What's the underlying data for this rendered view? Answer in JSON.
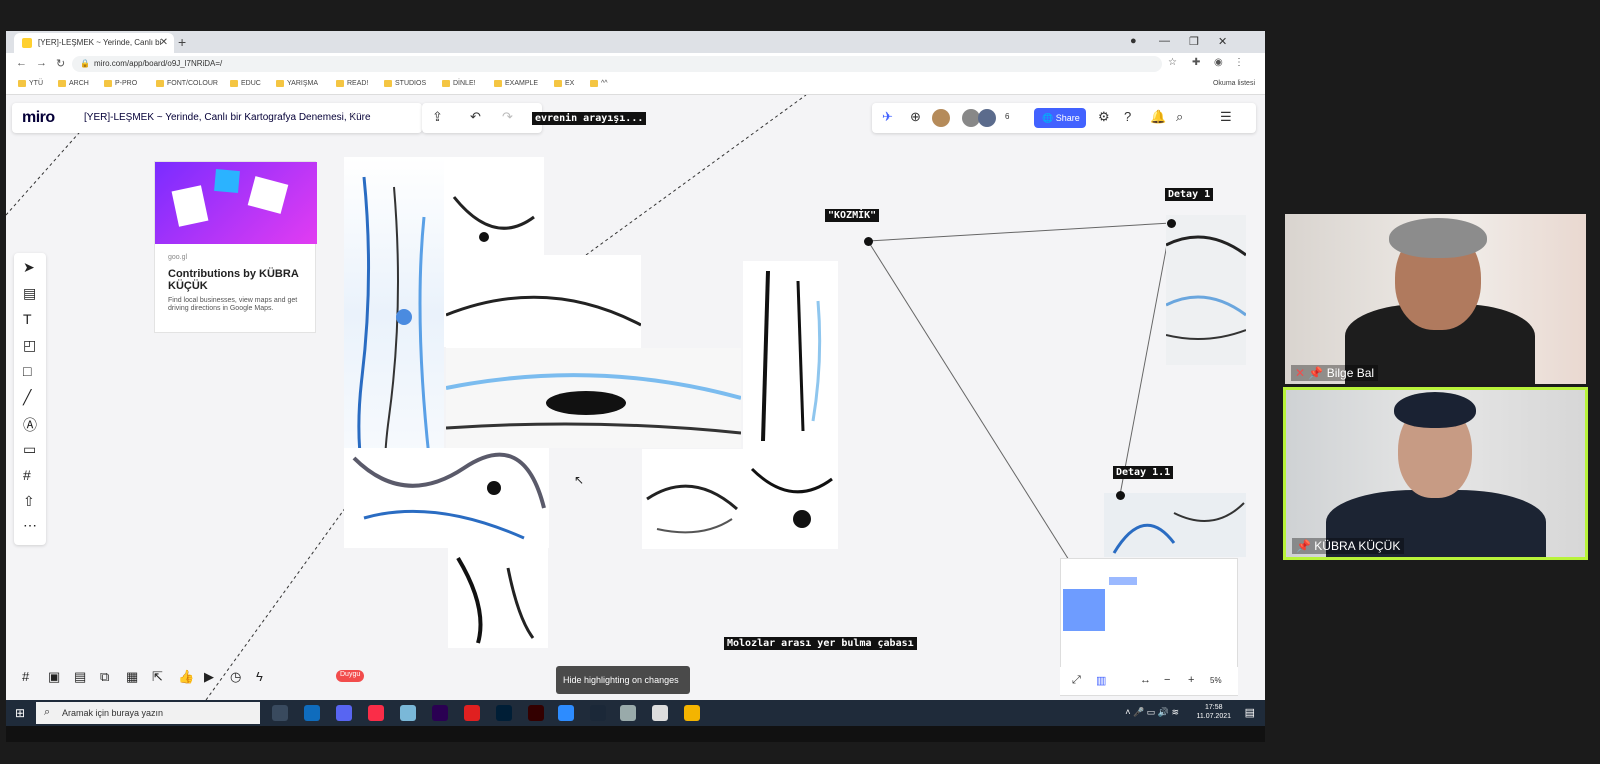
{
  "browser": {
    "tab_title": "[YER]-LEŞMEK ~ Yerinde, Canlı bi",
    "url": "miro.com/app/board/o9J_l7NRiDA=/",
    "bookmarks": [
      "YTÜ",
      "ARCH",
      "P-PRO",
      "FONT/COLOUR",
      "EDUC",
      "YARIŞMA",
      "READ!",
      "STUDIOS",
      "DİNLE!",
      "EXAMPLE",
      "EX",
      "^^"
    ],
    "reading_list": "Okuma listesi"
  },
  "miro": {
    "logo": "miro",
    "board_title": "[YER]-LEŞMEK ~ Yerinde, Canlı bir Kartografya Denemesi, Küre",
    "participant_count": "6",
    "share_label": "Share",
    "zoom_level": "5%",
    "tooltip": "Hide highlighting on changes",
    "collaborator_cursor": "Duygu",
    "card": {
      "source": "goo.gl",
      "title": "Contributions by KÜBRA KÜÇÜK",
      "description": "Find local businesses, view maps and get driving directions in Google Maps."
    },
    "labels": {
      "evren": "evrenin arayışı...",
      "kozmik": "\"KOZMİK\"",
      "detay1": "Detay 1",
      "detay11": "Detay 1.1",
      "molozlar": "Molozlar arası yer bulma çabası"
    }
  },
  "taskbar": {
    "search_placeholder": "Aramak için buraya yazın",
    "time": "17:58",
    "date": "11.07.2021"
  },
  "participants": [
    {
      "name": "Bilge Bal"
    },
    {
      "name": "KÜBRA KÜÇÜK"
    }
  ],
  "colors": {
    "accent": "#4262ff",
    "speaker_border": "#b8f33a"
  }
}
